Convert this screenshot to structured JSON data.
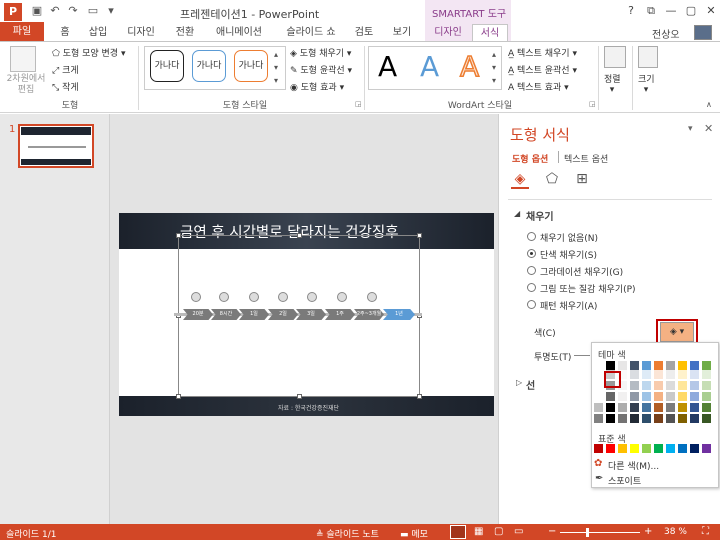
{
  "window": {
    "title": "프레젠테이션1 - PowerPoint",
    "contextual_tab_group": "SMARTART 도구",
    "user": "전상오",
    "app_logo": "P"
  },
  "tabs": [
    "홈",
    "삽입",
    "디자인",
    "전환",
    "애니메이션",
    "슬라이드 쇼",
    "검토",
    "보기",
    "디자인",
    "서식"
  ],
  "file_tab": "파일",
  "ribbon": {
    "shape_group": {
      "edit_2d": "2차원에서 편집",
      "change_shape": "도형 모양 변경",
      "larger": "크게",
      "smaller": "작게",
      "label": "도형"
    },
    "shape_styles": {
      "samples": [
        "가나다",
        "가나다",
        "가나다"
      ],
      "fill": "도형 채우기",
      "outline": "도형 윤곽선",
      "effects": "도형 효과",
      "label": "도형 스타일"
    },
    "wordart": {
      "samples": [
        "A",
        "A",
        "A"
      ],
      "text_fill": "텍스트 채우기",
      "text_outline": "텍스트 윤곽선",
      "text_effects": "텍스트 효과",
      "label": "WordArt 스타일"
    },
    "arrange": "정렬",
    "size": "크기"
  },
  "thumbnail": {
    "number": "1"
  },
  "slide": {
    "title": "금연 후 시간별로 달라지는 건강징후",
    "steps": [
      "20분",
      "8시간",
      "1일",
      "2일",
      "3일",
      "1주",
      "2주~3개월",
      "3~9개월",
      "1년"
    ],
    "footer": "자료 : 한국건강증진재단"
  },
  "format_pane": {
    "title": "도형 서식",
    "tab_shape": "도형 옵션",
    "tab_text": "텍스트 옵션",
    "fill_section": "채우기",
    "options": [
      "채우기 없음(N)",
      "단색 채우기(S)",
      "그라데이션 채우기(G)",
      "그림 또는 질감 채우기(P)",
      "패턴 채우기(A)"
    ],
    "selected_option": 1,
    "color_label": "색(C)",
    "transparency_label": "투명도(T)",
    "line_section": "선"
  },
  "palette": {
    "theme_label": "테마 색",
    "standard_label": "표준 색",
    "more_colors": "다른 색(M)...",
    "eyedropper": "스포이트",
    "theme_top": [
      "#ffffff",
      "#000000",
      "#e7e6e6",
      "#44546a",
      "#5b9bd5",
      "#ed7d31",
      "#a5a5a5",
      "#ffc000",
      "#4472c4",
      "#70ad47",
      "#264478",
      "#9e480e"
    ],
    "standard": [
      "#c00000",
      "#ff0000",
      "#ffc000",
      "#ffff00",
      "#92d050",
      "#00b050",
      "#00b0f0",
      "#0070c0",
      "#002060",
      "#7030a0",
      "#ff0000",
      "#00b050"
    ]
  },
  "status": {
    "slide_info": "슬라이드 1/1",
    "notes": "슬라이드 노트",
    "comments": "메모",
    "zoom": "38 %"
  }
}
